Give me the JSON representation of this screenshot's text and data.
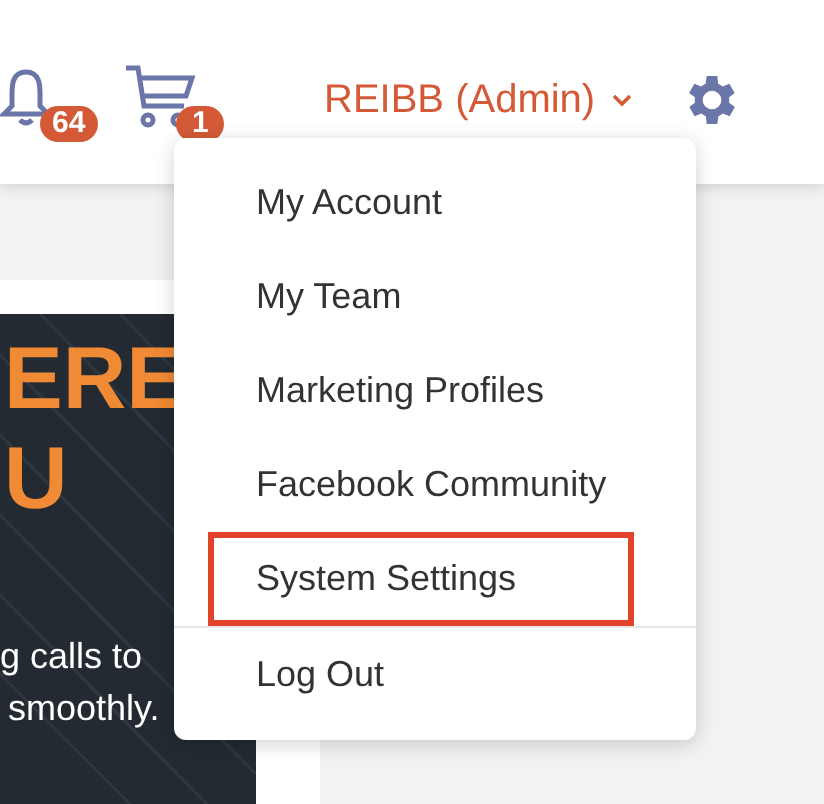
{
  "header": {
    "notifications": {
      "count": "64"
    },
    "cart": {
      "count": "1"
    },
    "user_menu": {
      "label": "REIBB (Admin)",
      "expanded": true
    }
  },
  "banner": {
    "headline": [
      "ERE",
      "U"
    ],
    "text": [
      "g calls to",
      "smoothly."
    ]
  },
  "dropdown": {
    "items": [
      {
        "label": "My Account",
        "highlighted": false,
        "divider_before": false
      },
      {
        "label": "My Team",
        "highlighted": false,
        "divider_before": false
      },
      {
        "label": "Marketing Profiles",
        "highlighted": false,
        "divider_before": false
      },
      {
        "label": "Facebook Community",
        "highlighted": false,
        "divider_before": false
      },
      {
        "label": "System Settings",
        "highlighted": true,
        "divider_before": false
      },
      {
        "label": "Log Out",
        "highlighted": false,
        "divider_before": true
      }
    ]
  }
}
